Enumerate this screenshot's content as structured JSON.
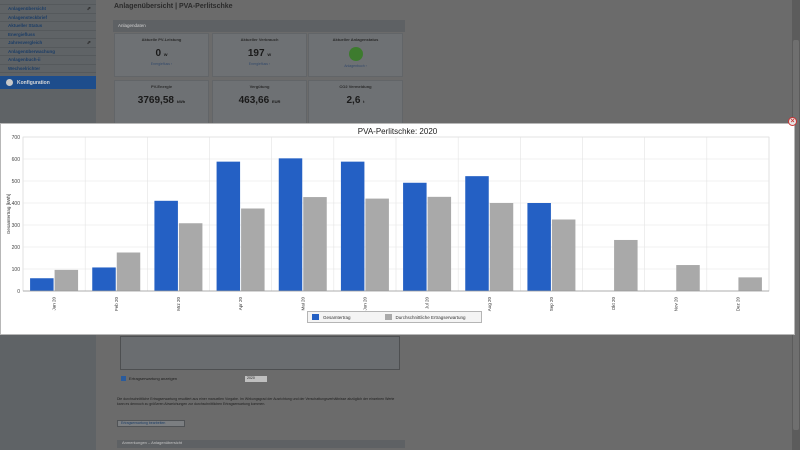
{
  "page": {
    "title": "Anlagenübersicht | PVA-Perlitschke",
    "section_label": "Anlagendaten"
  },
  "sidebar": {
    "items": [
      {
        "label": "Anlagenübersicht",
        "ext": "⇗"
      },
      {
        "label": "Anlagensteckbrief",
        "ext": ""
      },
      {
        "label": "Aktueller Status",
        "ext": ""
      },
      {
        "label": "Energiefluss",
        "ext": ""
      },
      {
        "label": "Jahresvergleich",
        "ext": "⇗"
      },
      {
        "label": "Anlagenüberwachung",
        "ext": ""
      },
      {
        "label": "Anlagenbuch-ii",
        "ext": ""
      },
      {
        "label": "Wechselrichter",
        "ext": ""
      }
    ],
    "profile_label": "Konfiguration"
  },
  "tiles": [
    {
      "label": "Aktuelle PV-Leistung",
      "value": "0",
      "unit": "W",
      "link": "Energiefluss ›"
    },
    {
      "label": "Aktueller Verbrauch",
      "value": "197",
      "unit": "W",
      "link": "Energiefluss ›"
    },
    {
      "label": "Aktueller Anlagenstatus",
      "value": "",
      "unit": "",
      "link": "Anlagenbuch ›"
    },
    {
      "label": "PV-Energie",
      "value": "3769,58",
      "unit": "kWh",
      "link": ""
    },
    {
      "label": "Vergütung",
      "value": "463,66",
      "unit": "EUR",
      "link": ""
    },
    {
      "label": "CO2 Vermeidung",
      "value": "2,6",
      "unit": "t",
      "link": ""
    }
  ],
  "lower": {
    "checkbox_label": "Ertragserwartung anzeigen",
    "year_select": "2020",
    "note": "Die durchschnittliche Ertragserwartung resultiert aus einer manuellen Vorgabe. Im Wirkungsgrad der Ausrichtung und der Verschattungsverhältnisse abzüglich der einzelnen Werte kann es dennoch zu größeren Abweichungen zur durchschnittlichen Ertragserwartung kommen.",
    "button": "Ertragserwartung bearbeiten",
    "footer": "Anmerkungen – Anlagenübersicht"
  },
  "modal": {
    "close_label": "×"
  },
  "colors": {
    "gesamt": "#2460c4",
    "erwartung": "#a9a9a9"
  },
  "chart_data": {
    "type": "bar",
    "title": "PVA-Perlitschke: 2020",
    "ylabel": "Gesamtertrag [kWh]",
    "xlabel": "",
    "ylim": [
      0,
      700
    ],
    "yticks": [
      0,
      100,
      200,
      300,
      400,
      500,
      600,
      700
    ],
    "grid": true,
    "legend_position": "bottom-center",
    "categories": [
      "Jan 20",
      "Feb 20",
      "Mrz 20",
      "Apr 20",
      "Mai 20",
      "Jun 20",
      "Jul 20",
      "Aug 20",
      "Sep 20",
      "Okt 20",
      "Nov 20",
      "Dez 20"
    ],
    "series": [
      {
        "name": "Gesamtertrag",
        "values": [
          58,
          107,
          410,
          588,
          603,
          588,
          492,
          522,
          400,
          null,
          null,
          null
        ]
      },
      {
        "name": "Durchschnittliche Ertragserwartung",
        "values": [
          96,
          175,
          308,
          375,
          427,
          420,
          428,
          400,
          325,
          232,
          118,
          62
        ]
      }
    ]
  }
}
